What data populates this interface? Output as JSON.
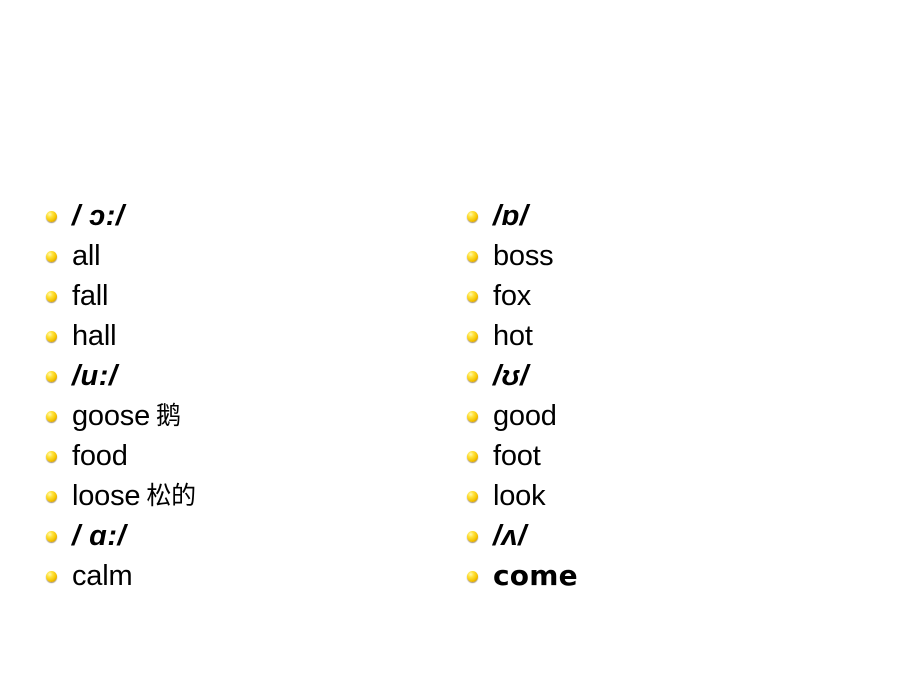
{
  "slide": {
    "background_color": "#ffffff",
    "text_color": "#000000",
    "bullet_color": "#f5c400",
    "columns": [
      {
        "id": "left",
        "items": [
          {
            "kind": "phoneme",
            "text": "/ ɔ:/"
          },
          {
            "kind": "word",
            "text": "all"
          },
          {
            "kind": "word",
            "text": "fall"
          },
          {
            "kind": "word",
            "text": "hall"
          },
          {
            "kind": "phoneme",
            "text": "/u:/"
          },
          {
            "kind": "word",
            "text": "goose",
            "gloss": "鹅"
          },
          {
            "kind": "word",
            "text": "food"
          },
          {
            "kind": "word",
            "text": "loose",
            "gloss": "松的"
          },
          {
            "kind": "phoneme",
            "text": "/ ɑ:/"
          },
          {
            "kind": "word",
            "text": "calm"
          }
        ]
      },
      {
        "id": "right",
        "items": [
          {
            "kind": "phoneme",
            "text": "/ɒ/"
          },
          {
            "kind": "word",
            "text": "boss"
          },
          {
            "kind": "word",
            "text": "fox"
          },
          {
            "kind": "word",
            "text": "hot"
          },
          {
            "kind": "phoneme",
            "text": "/ʊ/"
          },
          {
            "kind": "word",
            "text": "good"
          },
          {
            "kind": "word",
            "text": "foot"
          },
          {
            "kind": "word",
            "text": "look"
          },
          {
            "kind": "phoneme",
            "text": "/ʌ/"
          },
          {
            "kind": "word-strong",
            "text": "come"
          }
        ]
      }
    ]
  }
}
